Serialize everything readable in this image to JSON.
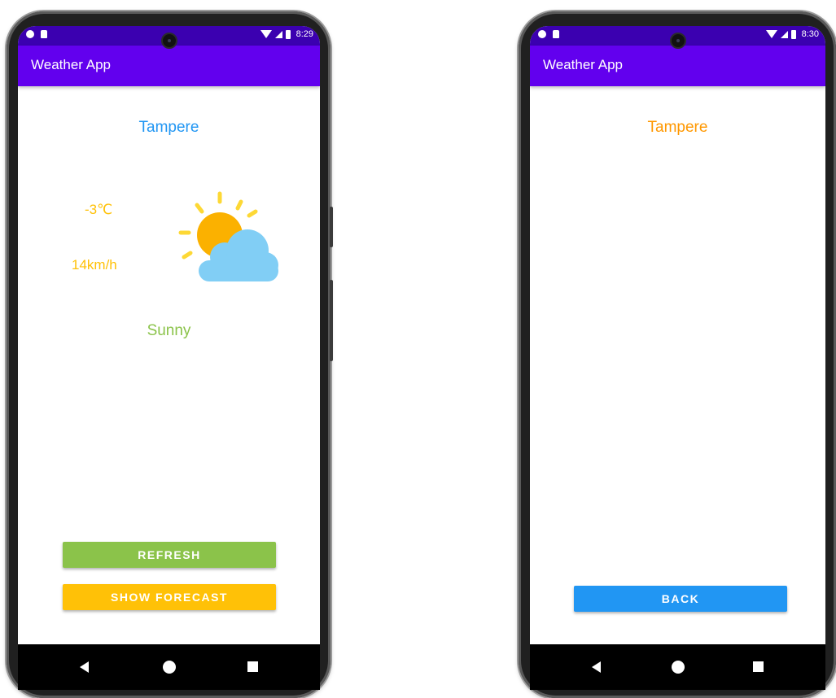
{
  "screens": [
    {
      "id": "main",
      "status_time": "8:29",
      "app_title": "Weather App",
      "city": "Tampere",
      "temperature": "-3℃",
      "wind": "14km/h",
      "condition": "Sunny",
      "weather_icon": "sun-behind-cloud-icon",
      "buttons": {
        "refresh": "REFRESH",
        "show_forecast": "SHOW FORECAST"
      }
    },
    {
      "id": "forecast",
      "status_time": "8:30",
      "app_title": "Weather App",
      "city": "Tampere",
      "buttons": {
        "back": "BACK"
      }
    }
  ],
  "colors": {
    "status_bar": "#3b00b0",
    "app_bar": "#6200ee",
    "city_main": "#2196f3",
    "city_forecast": "#ff9800",
    "temp_wind": "#ffc107",
    "condition": "#8bc34a",
    "refresh_button": "#8bc34a",
    "forecast_button": "#ffc107",
    "back_button": "#2196f3"
  }
}
